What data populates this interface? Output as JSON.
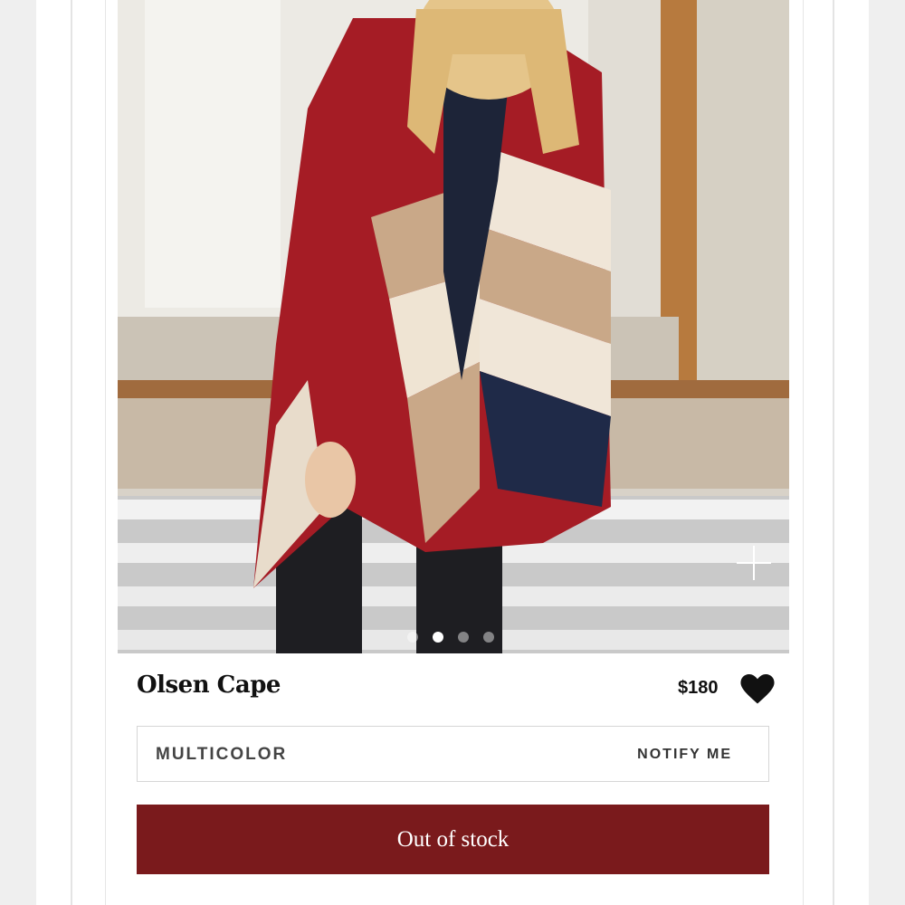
{
  "product": {
    "name": "Olsen Cape",
    "price": "$180",
    "favorited": true,
    "carousel": {
      "total": 4,
      "active": 1
    }
  },
  "variant": {
    "color_label": "MULTICOLOR",
    "notify_label": "NOTIFY ME"
  },
  "stock_button": {
    "label": "Out of stock",
    "color": "#7a1a1c"
  },
  "icons": {
    "add": "plus-icon",
    "favorite": "heart-icon"
  }
}
